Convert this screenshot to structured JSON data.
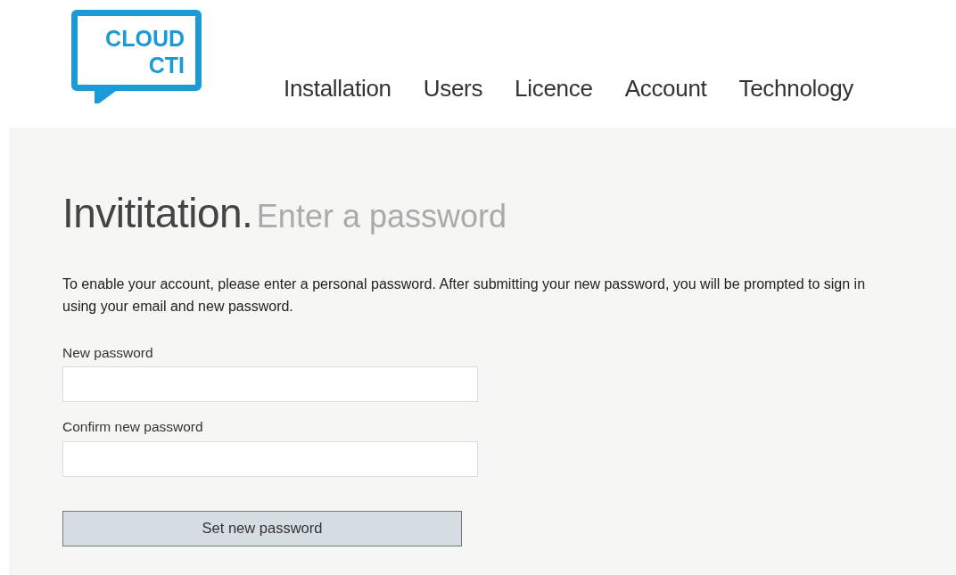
{
  "logo": {
    "lines": [
      "CLOUD",
      "CTI"
    ]
  },
  "nav": [
    {
      "label": "Installation"
    },
    {
      "label": "Users"
    },
    {
      "label": "Licence"
    },
    {
      "label": "Account"
    },
    {
      "label": "Technology"
    }
  ],
  "heading": {
    "title": "Invititation.",
    "subtitle": "Enter a password"
  },
  "intro": "To enable your account, please enter a personal password. After submitting your new password, you will be prompted to sign in using your email and new password.",
  "fields": [
    {
      "label": "New password"
    },
    {
      "label": "Confirm new password"
    }
  ],
  "submit": "Set new password"
}
